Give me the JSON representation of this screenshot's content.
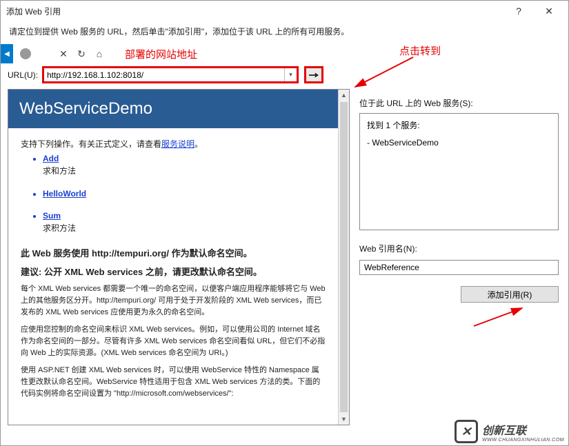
{
  "window": {
    "title": "添加 Web 引用",
    "help_icon": "?",
    "close_icon": "✕"
  },
  "instructions": "请定位到提供 Web 服务的 URL，然后单击\"添加引用\"，添加位于该 URL 上的所有可用服务。",
  "annotations": {
    "deployed_site": "部署的网站地址",
    "click_go": "点击转到"
  },
  "url": {
    "label": "URL(U):",
    "value": "http://192.168.1.102:8018/"
  },
  "service_page": {
    "header": "WebServiceDemo",
    "support_text_prefix": "支持下列操作。有关正式定义，请查看",
    "support_link": "服务说明",
    "support_text_suffix": "。",
    "operations": [
      {
        "name": "Add",
        "desc": "求和方法"
      },
      {
        "name": "HelloWorld",
        "desc": ""
      },
      {
        "name": "Sum",
        "desc": "求积方法"
      }
    ],
    "namespace_line": "此 Web 服务使用 http://tempuri.org/ 作为默认命名空间。",
    "suggest_line": "建议: 公开 XML Web services 之前，请更改默认命名空间。",
    "para1": "每个 XML Web services 都需要一个唯一的命名空间，以便客户端应用程序能够将它与 Web 上的其他服务区分开。http://tempuri.org/ 可用于处于开发阶段的 XML Web services，而已发布的 XML Web services 应使用更为永久的命名空间。",
    "para2": "应使用您控制的命名空间来标识 XML Web services。例如，可以使用公司的 Internet 域名作为命名空间的一部分。尽管有许多 XML Web services 命名空间看似 URL，但它们不必指向 Web 上的实际资源。(XML Web services 命名空间为 URI。)",
    "para3": "使用 ASP.NET 创建 XML Web services 时，可以使用 WebService 特性的 Namespace 属性更改默认命名空间。WebService 特性适用于包含 XML Web services 方法的类。下面的代码实例将命名空间设置为 \"http://microsoft.com/webservices/\":"
  },
  "right_panel": {
    "services_label": "位于此 URL 上的 Web 服务(S):",
    "found_text": "找到 1 个服务:",
    "service_item": "- WebServiceDemo",
    "refname_label": "Web 引用名(N):",
    "refname_value": "WebReference",
    "add_button": "添加引用(R)"
  },
  "logo": {
    "text": "创新互联",
    "sub": "WWW.CHUANGXINHULIAN.COM"
  }
}
